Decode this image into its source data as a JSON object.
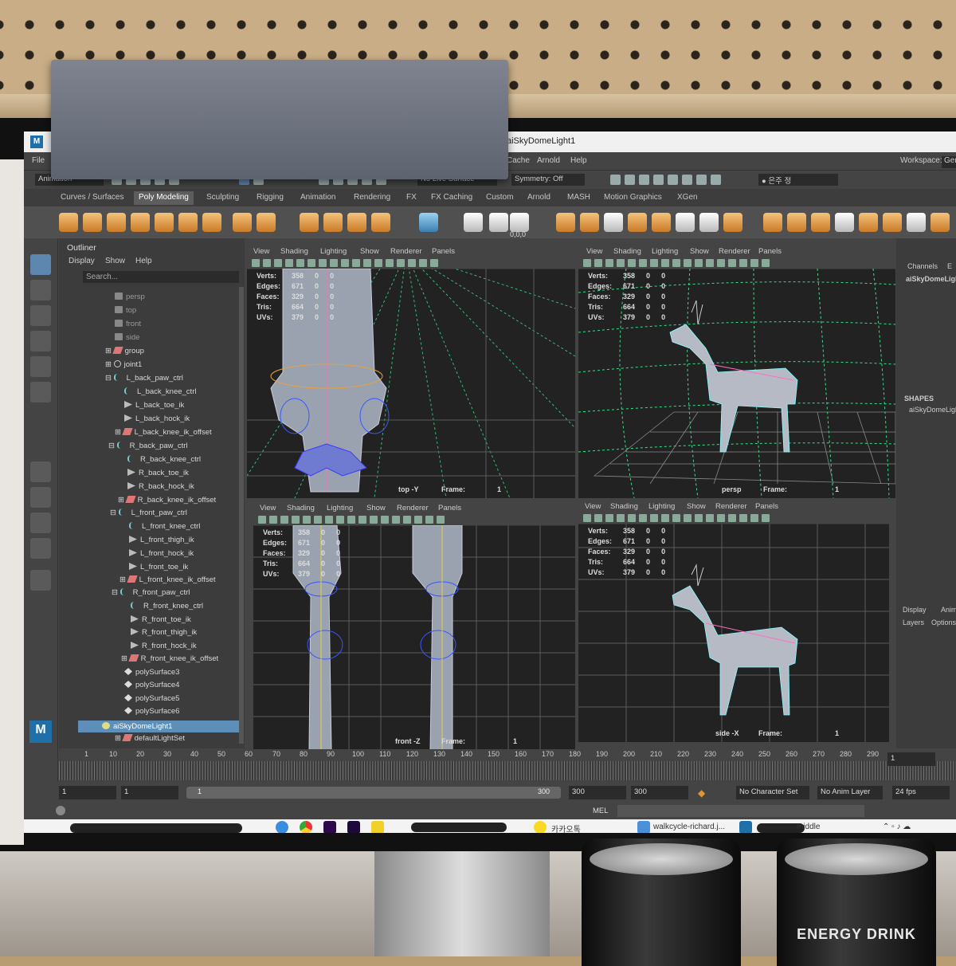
{
  "window": {
    "title": "aiSkyDomeLight1"
  },
  "menubar": {
    "file": "File",
    "cache": "Cache",
    "arnold": "Arnold",
    "help": "Help",
    "workspace_label": "Workspace:",
    "workspace_value": "Ger"
  },
  "statusline": {
    "mode": "Animation",
    "live_surface": "No Live Surface",
    "symmetry": "Symmetry: Off",
    "user": "은주 정"
  },
  "shelf_tabs": [
    "Curves / Surfaces",
    "Poly Modeling",
    "Sculpting",
    "Rigging",
    "Animation",
    "Rendering",
    "FX",
    "FX Caching",
    "Custom",
    "Arnold",
    "MASH",
    "Motion Graphics",
    "XGen"
  ],
  "shelf_active": "Poly Modeling",
  "shelf_extra": {
    "coords": "0,0,0"
  },
  "outliner": {
    "title": "Outliner",
    "menu": [
      "Display",
      "Show",
      "Help"
    ],
    "search_placeholder": "Search...",
    "items": [
      "persp",
      "top",
      "front",
      "side",
      "group",
      "joint1",
      "L_back_paw_ctrl",
      "L_back_knee_ctrl",
      "L_back_toe_ik",
      "L_back_hock_ik",
      "L_back_knee_ik_offset",
      "R_back_paw_ctrl",
      "R_back_knee_ctrl",
      "R_back_toe_ik",
      "R_back_hock_ik",
      "R_back_knee_ik_offset",
      "L_front_paw_ctrl",
      "L_front_knee_ctrl",
      "L_front_thigh_ik",
      "L_front_hock_ik",
      "L_front_toe_ik",
      "L_front_knee_ik_offset",
      "R_front_paw_ctrl",
      "R_front_knee_ctrl",
      "R_front_toe_ik",
      "R_front_thigh_ik",
      "R_front_hock_ik",
      "R_front_knee_ik_offset",
      "polySurface3",
      "polySurface4",
      "polySurface5",
      "polySurface6",
      "aiSkyDomeLight1",
      "defaultLightSet"
    ],
    "selected": "aiSkyDomeLight1"
  },
  "viewport_menu": [
    "View",
    "Shading",
    "Lighting",
    "Show",
    "Renderer",
    "Panels"
  ],
  "hud": {
    "labels": [
      "Verts:",
      "Edges:",
      "Faces:",
      "Tris:",
      "UVs:"
    ],
    "values": [
      "358",
      "671",
      "329",
      "664",
      "379"
    ],
    "zero": "0",
    "frame_label": "Frame:",
    "frame_value": "1"
  },
  "viewports": {
    "top": "top -Y",
    "persp": "persp",
    "front": "front -Z",
    "side": "side -X"
  },
  "right_panel": {
    "channels": "Channels",
    "edit_abbr": "E",
    "node": "aiSkyDomeLigh",
    "shapes": "SHAPES",
    "shape_node": "aiSkyDomeLigh",
    "display": "Display",
    "anim": "Anim",
    "layers": "Layers",
    "options": "Options"
  },
  "timeline": {
    "ticks": [
      "1",
      "10",
      "20",
      "30",
      "40",
      "50",
      "60",
      "70",
      "80",
      "90",
      "100",
      "110",
      "120",
      "130",
      "140",
      "150",
      "160",
      "170",
      "180",
      "190",
      "200",
      "210",
      "220",
      "230",
      "240",
      "250",
      "260",
      "270",
      "280",
      "290"
    ],
    "current": "1"
  },
  "range": {
    "start": "1",
    "playback_start": "1",
    "slider_start": "1",
    "slider_end": "300",
    "playback_end": "300",
    "end": "300",
    "character_set": "No Character Set",
    "anim_layer": "No Anim Layer",
    "fps": "24 fps"
  },
  "command": {
    "label": "MEL"
  },
  "taskbar": {
    "kakao": "카카오톡",
    "walk": "walkcycle-richard.j...",
    "maya_fragment": "middle"
  },
  "can": {
    "brand": "ENERGY DRINK"
  },
  "colors": {
    "viewport_bg": "#222222",
    "grid_green": "#38e08a",
    "selection": "#5d8fb8",
    "maya_blue": "#1f6fa8",
    "shelf_orange": "#e0952e"
  }
}
